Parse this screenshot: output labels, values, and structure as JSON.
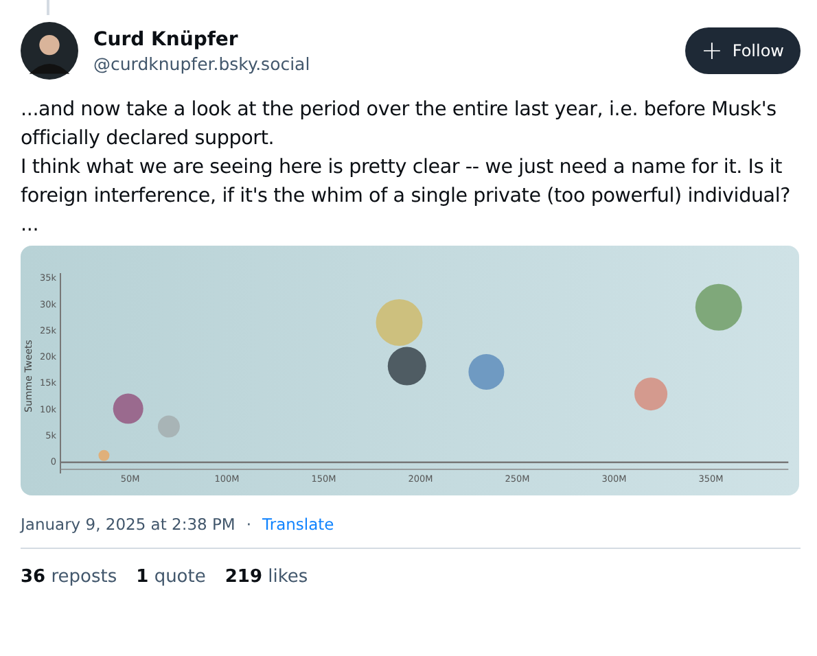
{
  "author": {
    "name": "Curd Knüpfer",
    "handle": "@curdknupfer.bsky.social"
  },
  "follow_button": {
    "icon": "+",
    "label": "Follow"
  },
  "post": {
    "lines": [
      "...and now take a look at the period over the entire last year, i.e. before Musk's officially declared support.",
      "I think what we are seeing here is pretty clear -- we just need a name for it. Is it foreign interference, if it's the whim of a single private (too powerful) individual?",
      "..."
    ],
    "chart_data": {
      "type": "scatter",
      "ylabel": "Summe Tweets",
      "xlim": [
        14,
        390
      ],
      "ylim": [
        -2,
        36
      ],
      "x": [
        36.5,
        49,
        70,
        189,
        193,
        234,
        319,
        354
      ],
      "series": [
        {
          "color": "#e0b07a",
          "values": [
            1.3,
            null,
            null,
            null,
            null,
            null,
            null,
            null
          ]
        },
        {
          "color": "#9a6a8e",
          "values": [
            null,
            10.2,
            null,
            null,
            null,
            null,
            null,
            null
          ]
        },
        {
          "color": "#a8b4b6",
          "values": [
            null,
            null,
            6.8,
            null,
            null,
            null,
            null,
            null
          ]
        },
        {
          "color": "#cdc07e",
          "values": [
            null,
            null,
            null,
            26.6,
            null,
            null,
            null,
            null
          ]
        },
        {
          "color": "#4f5c63",
          "values": [
            null,
            null,
            null,
            null,
            18.3,
            null,
            null,
            null
          ]
        },
        {
          "color": "#6f9ac2",
          "values": [
            null,
            null,
            null,
            null,
            null,
            17.2,
            null,
            null
          ]
        },
        {
          "color": "#d49a8e",
          "values": [
            null,
            null,
            null,
            null,
            null,
            null,
            13,
            null
          ]
        },
        {
          "color": "#7fa87a",
          "values": [
            null,
            null,
            null,
            null,
            null,
            null,
            null,
            29.5
          ]
        }
      ],
      "ref_lines": [
        {
          "axis": "y",
          "value": 0
        }
      ],
      "xticks": [
        {
          "value": 50,
          "label": "50M"
        },
        {
          "value": 100,
          "label": "100M"
        },
        {
          "value": 150,
          "label": "150M"
        },
        {
          "value": 200,
          "label": "200M"
        },
        {
          "value": 250,
          "label": "250M"
        },
        {
          "value": 300,
          "label": "300M"
        },
        {
          "value": 350,
          "label": "350M"
        }
      ],
      "yticks": [
        {
          "value": 35,
          "label": "35k"
        },
        {
          "value": 30,
          "label": "30k"
        },
        {
          "value": 25,
          "label": "25k"
        },
        {
          "value": 20,
          "label": "20k"
        },
        {
          "value": 15,
          "label": "15k"
        },
        {
          "value": 10,
          "label": "10k"
        },
        {
          "value": 5,
          "label": "5k"
        },
        {
          "value": 0,
          "label": "0"
        }
      ]
    }
  },
  "timestamp": "January 9, 2025 at 2:38 PM",
  "separator": "·",
  "translate_link": "Translate",
  "stats": [
    {
      "count": "36",
      "label": "reposts"
    },
    {
      "count": "1",
      "label": "quote"
    },
    {
      "count": "219",
      "label": "likes"
    }
  ]
}
